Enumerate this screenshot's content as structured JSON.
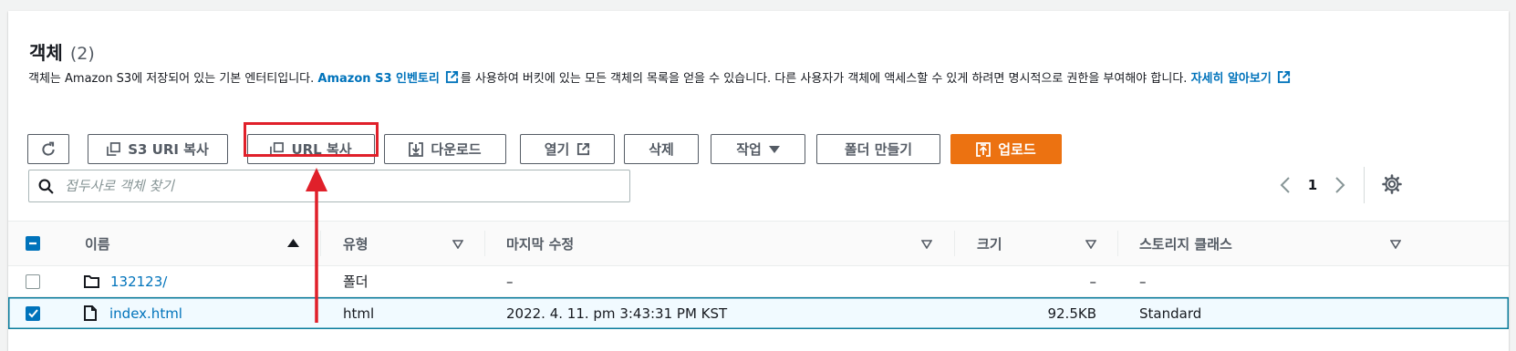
{
  "section": {
    "title": "객체",
    "count": "(2)",
    "description_1": "객체는 Amazon S3에 저장되어 있는 기본 엔터티입니다.",
    "inventory_link": "Amazon S3 인벤토리",
    "description_2": "를 사용하여 버킷에 있는 모든 객체의 목록을 얻을 수 있습니다. 다른 사용자가 객체에 액세스할 수 있게 하려면 명시적으로 권한을 부여해야 합니다.",
    "learn_more_link": "자세히 알아보기"
  },
  "toolbar": {
    "s3_uri_copy": "S3 URI 복사",
    "url_copy": "URL 복사",
    "download": "다운로드",
    "open": "열기",
    "delete": "삭제",
    "actions": "작업",
    "create_folder": "폴더 만들기",
    "upload": "업로드"
  },
  "search": {
    "placeholder": "접두사로 객체 찾기",
    "value": ""
  },
  "pagination": {
    "current_page": "1"
  },
  "table": {
    "columns": [
      "이름",
      "유형",
      "마지막 수정",
      "크기",
      "스토리지 클래스"
    ],
    "rows": [
      {
        "name": "132123/",
        "type": "폴더",
        "modified": "–",
        "size": "–",
        "storage_class": "–",
        "icon": "folder-icon",
        "checked": false
      },
      {
        "name": "index.html",
        "type": "html",
        "modified": "2022. 4. 11. pm 3:43:31 PM KST",
        "size": "92.5KB",
        "storage_class": "Standard",
        "icon": "file-icon",
        "checked": true
      }
    ]
  },
  "colors": {
    "primary": "#ec7211",
    "link": "#0073bb",
    "highlight": "#e0202a",
    "selected_row_border": "#0a7c9c"
  }
}
